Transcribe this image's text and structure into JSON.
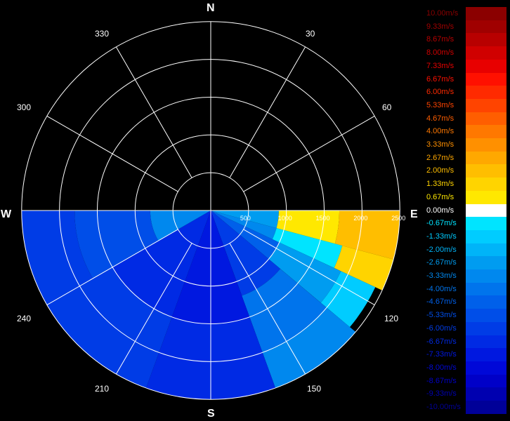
{
  "compass": {
    "north": "N",
    "east": "E",
    "south": "S",
    "west": "W"
  },
  "bearings": [
    "30",
    "60",
    "120",
    "150",
    "210",
    "240",
    "300",
    "330"
  ],
  "chart_data": {
    "type": "heatmap",
    "subtype": "polar-ppi-radial-velocity",
    "range_rings": [
      500,
      1000,
      1500,
      2000,
      2500
    ],
    "range_ring_labels": [
      "500",
      "1000",
      "1500",
      "2000",
      "2500"
    ],
    "radial_spokes_deg": [
      0,
      30,
      60,
      90,
      120,
      150,
      180,
      210,
      240,
      270,
      300,
      330
    ],
    "scan_sector_deg": [
      90,
      270
    ],
    "max_range": 2600,
    "colorscale": [
      {
        "label": "10.00m/s",
        "value": 10.0,
        "color": "#8b0000"
      },
      {
        "label": "9.33m/s",
        "value": 9.33,
        "color": "#a00000"
      },
      {
        "label": "8.67m/s",
        "value": 8.67,
        "color": "#b80000"
      },
      {
        "label": "8.00m/s",
        "value": 8.0,
        "color": "#d00000"
      },
      {
        "label": "7.33m/s",
        "value": 7.33,
        "color": "#e80000"
      },
      {
        "label": "6.67m/s",
        "value": 6.67,
        "color": "#ff1000"
      },
      {
        "label": "6.00m/s",
        "value": 6.0,
        "color": "#ff2a00"
      },
      {
        "label": "5.33m/s",
        "value": 5.33,
        "color": "#ff4400"
      },
      {
        "label": "4.67m/s",
        "value": 4.67,
        "color": "#ff5e00"
      },
      {
        "label": "4.00m/s",
        "value": 4.0,
        "color": "#ff7800"
      },
      {
        "label": "3.33m/s",
        "value": 3.33,
        "color": "#ff9000"
      },
      {
        "label": "2.67m/s",
        "value": 2.67,
        "color": "#ffa800"
      },
      {
        "label": "2.00m/s",
        "value": 2.0,
        "color": "#ffbe00"
      },
      {
        "label": "1.33m/s",
        "value": 1.33,
        "color": "#ffd400"
      },
      {
        "label": "0.67m/s",
        "value": 0.67,
        "color": "#ffe800"
      },
      {
        "label": "0.00m/s",
        "value": 0.0,
        "color": "#ffffff"
      },
      {
        "label": "-0.67m/s",
        "value": -0.67,
        "color": "#00e4ff"
      },
      {
        "label": "-1.33m/s",
        "value": -1.33,
        "color": "#00ccff"
      },
      {
        "label": "-2.00m/s",
        "value": -2.0,
        "color": "#00b4f8"
      },
      {
        "label": "-2.67m/s",
        "value": -2.67,
        "color": "#009cf0"
      },
      {
        "label": "-3.33m/s",
        "value": -3.33,
        "color": "#0088ee"
      },
      {
        "label": "-4.00m/s",
        "value": -4.0,
        "color": "#0074ec"
      },
      {
        "label": "-4.67m/s",
        "value": -4.67,
        "color": "#0060ea"
      },
      {
        "label": "-5.33m/s",
        "value": -5.33,
        "color": "#004ee8"
      },
      {
        "label": "-6.00m/s",
        "value": -6.0,
        "color": "#003ce6"
      },
      {
        "label": "-6.67m/s",
        "value": -6.67,
        "color": "#002ae4"
      },
      {
        "label": "-7.33m/s",
        "value": -7.33,
        "color": "#0018e0"
      },
      {
        "label": "-8.00m/s",
        "value": -8.0,
        "color": "#0008d8"
      },
      {
        "label": "-8.67m/s",
        "value": -8.67,
        "color": "#0000c8"
      },
      {
        "label": "-9.33m/s",
        "value": -9.33,
        "color": "#0000b0"
      },
      {
        "label": "-10.00m/s",
        "value": -10.0,
        "color": "#000098"
      }
    ],
    "sectors": [
      {
        "az_start": 90,
        "az_end": 105,
        "r_start": 0,
        "r_end": 900,
        "velocity": -2.5
      },
      {
        "az_start": 90,
        "az_end": 105,
        "r_start": 900,
        "r_end": 1700,
        "velocity": 0.67
      },
      {
        "az_start": 90,
        "az_end": 105,
        "r_start": 1700,
        "r_end": 2500,
        "velocity": 2.0
      },
      {
        "az_start": 105,
        "az_end": 115,
        "r_start": 0,
        "r_end": 900,
        "velocity": -3.5
      },
      {
        "az_start": 105,
        "az_end": 115,
        "r_start": 900,
        "r_end": 1800,
        "velocity": -1.0
      },
      {
        "az_start": 105,
        "az_end": 115,
        "r_start": 1800,
        "r_end": 2500,
        "velocity": 1.33
      },
      {
        "az_start": 115,
        "az_end": 130,
        "r_start": 0,
        "r_end": 1000,
        "velocity": -4.5
      },
      {
        "az_start": 115,
        "az_end": 130,
        "r_start": 1000,
        "r_end": 1900,
        "velocity": -2.5
      },
      {
        "az_start": 115,
        "az_end": 130,
        "r_start": 1900,
        "r_end": 2400,
        "velocity": -1.33
      },
      {
        "az_start": 130,
        "az_end": 160,
        "r_start": 0,
        "r_end": 1200,
        "velocity": -6.0
      },
      {
        "az_start": 130,
        "az_end": 160,
        "r_start": 1200,
        "r_end": 2000,
        "velocity": -4.0
      },
      {
        "az_start": 130,
        "az_end": 160,
        "r_start": 2000,
        "r_end": 2500,
        "velocity": -3.33
      },
      {
        "az_start": 160,
        "az_end": 200,
        "r_start": 0,
        "r_end": 1500,
        "velocity": -7.33
      },
      {
        "az_start": 160,
        "az_end": 200,
        "r_start": 1500,
        "r_end": 2500,
        "velocity": -6.67
      },
      {
        "az_start": 200,
        "az_end": 240,
        "r_start": 0,
        "r_end": 1500,
        "velocity": -7.0
      },
      {
        "az_start": 200,
        "az_end": 240,
        "r_start": 1500,
        "r_end": 2500,
        "velocity": -6.0
      },
      {
        "az_start": 240,
        "az_end": 270,
        "r_start": 0,
        "r_end": 800,
        "velocity": -3.33
      },
      {
        "az_start": 240,
        "az_end": 270,
        "r_start": 800,
        "r_end": 1800,
        "velocity": -5.33
      },
      {
        "az_start": 240,
        "az_end": 270,
        "r_start": 1800,
        "r_end": 2500,
        "velocity": -6.0
      }
    ]
  }
}
